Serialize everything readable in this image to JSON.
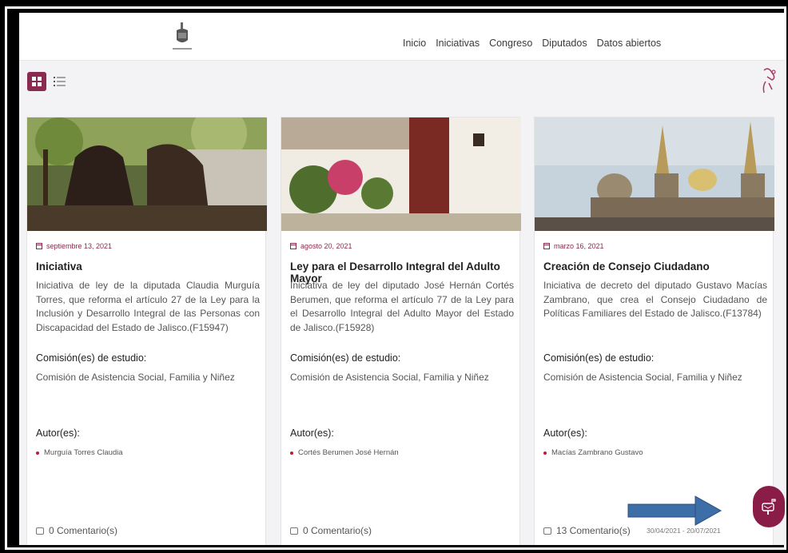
{
  "nav": {
    "items": [
      "Inicio",
      "Iniciativas",
      "Congreso",
      "Diputados",
      "Datos abiertos"
    ]
  },
  "cards": [
    {
      "date": "septiembre 13, 2021",
      "title": "Iniciativa",
      "description": "Iniciativa de ley de la diputada Claudia Murguía Torres, que reforma el artículo 27 de la Ley para la Inclusión y Desarrollo Integral de las Personas con Discapacidad del Estado de Jalisco.(F15947)",
      "commission_label": "Comisión(es) de estudio:",
      "commission": "Comisión de Asistencia Social, Familia y Niñez",
      "authors_label": "Autor(es):",
      "author": "Murguía Torres Claudia",
      "comments": "0 Comentario(s)",
      "range": "",
      "image": "bronze-sculpture-photo"
    },
    {
      "date": "agosto 20, 2021",
      "title": "Ley para el Desarrollo Integral del Adulto Mayor",
      "description": "Iniciativa de ley del diputado José Hernán Cortés Berumen, que reforma el artículo 77 de la Ley para el Desarrollo Integral del Adulto Mayor del Estado de Jalisco.(F15928)",
      "commission_label": "Comisión(es) de estudio:",
      "commission": "Comisión de Asistencia Social, Familia y Niñez",
      "authors_label": "Autor(es):",
      "author": "Cortés Berumen José Hernán",
      "comments": "0 Comentario(s)",
      "range": "",
      "image": "colonial-street-photo"
    },
    {
      "date": "marzo 16, 2021",
      "title": "Creación de Consejo Ciudadano",
      "description": "Iniciativa de decreto del diputado Gustavo Macías Zambrano, que crea el Consejo Ciudadano de Políticas Familiares del Estado de Jalisco.(F13784)",
      "commission_label": "Comisión(es) de estudio:",
      "commission": "Comisión de Asistencia Social, Familia y Niñez",
      "authors_label": "Autor(es):",
      "author": "Macías Zambrano Gustavo",
      "comments": "13 Comentario(s)",
      "range": "30/04/2021 - 20/07/2021",
      "image": "cathedral-photo"
    }
  ],
  "colors": {
    "accent": "#8a2a4e",
    "fab": "#8a1d48",
    "arrow": "#3d6ea8"
  },
  "icons": [
    "grid-view-icon",
    "list-view-icon",
    "gesture-icon",
    "calendar-icon",
    "comment-icon",
    "mailbox-icon",
    "arrow-right-icon"
  ]
}
